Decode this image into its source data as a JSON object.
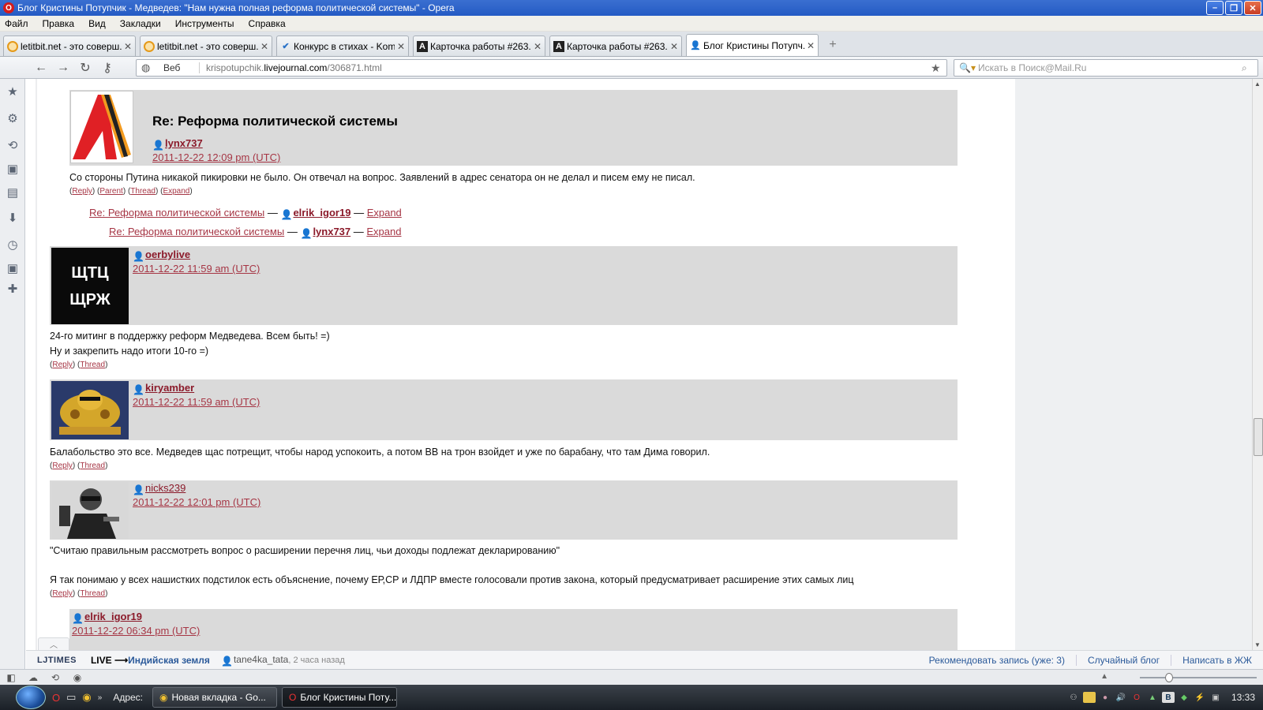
{
  "window": {
    "title": "Блог Кристины Потупчик - Медведев: \"Нам нужна полная реформа политической системы\" - Opera"
  },
  "menu": [
    "Файл",
    "Правка",
    "Вид",
    "Закладки",
    "Инструменты",
    "Справка"
  ],
  "tabs": [
    {
      "label": "letitbit.net - это соверш...",
      "icon": "letitbit-icon"
    },
    {
      "label": "letitbit.net - это соверш...",
      "icon": "letitbit-icon"
    },
    {
      "label": "Конкурс в стихах - Kom...",
      "icon": "konkurs-icon"
    },
    {
      "label": "Карточка работы #263...",
      "icon": "a-icon"
    },
    {
      "label": "Карточка работы #263...",
      "icon": "a-icon"
    },
    {
      "label": "Блог Кристины Потупч...",
      "icon": "lj-user-icon",
      "active": true
    }
  ],
  "address": {
    "mode": "Веб",
    "url_prefix": "krispotupchik.",
    "url_domain": "livejournal.com",
    "url_path": "/306871.html",
    "search_placeholder": "Искать в Поиск@Mail.Ru"
  },
  "comments": {
    "c1": {
      "heading": "Re: Реформа политической системы",
      "user": "lynx737",
      "date": "2011-12-22 12:09 pm (UTC)",
      "text": "Со стороны Путина никакой пикировки не было. Он отвечал на вопрос. Заявлений в адрес сенатора он не делал и писем ему не писал.",
      "links": [
        "Reply",
        "Parent",
        "Thread",
        "Expand"
      ]
    },
    "t1": {
      "title": "Re: Реформа политической системы",
      "user": "elrik_igor19",
      "expand": "Expand",
      "sep": "—"
    },
    "t2": {
      "title": "Re: Реформа политической системы",
      "user": "lynx737",
      "expand": "Expand",
      "sep": "—"
    },
    "c2": {
      "user": "oerbylive",
      "date": "2011-12-22 11:59 am (UTC)",
      "avatar_line1": "ЩТЦ",
      "avatar_line2": "ЩРЖ",
      "text1": "24-го митинг в поддержку реформ Медведева. Всем быть! =)",
      "text2": "Ну и закрепить надо итоги 10-го =)",
      "links": [
        "Reply",
        "Thread"
      ]
    },
    "c3": {
      "user": "kiryamber",
      "date": "2011-12-22 11:59 am (UTC)",
      "text": "Балабольство это все. Медведев щас потрещит, чтобы народ успокоить, а потом ВВ на трон взойдет и уже по барабану, что там Дима говорил.",
      "links": [
        "Reply",
        "Thread"
      ]
    },
    "c4": {
      "user": "nicks239",
      "date": "2011-12-22 12:01 pm (UTC)",
      "text1": "\"Считаю правильным рассмотреть вопрос о расширении перечня лиц, чьи доходы подлежат декларированию\"",
      "text2": "Я так понимаю у всех нашистких подстилок есть объяснение, почему ЕР,СР и ЛДПР вместе голосовали против закона, который предусматривает расширение этих самых лиц",
      "links": [
        "Reply",
        "Thread"
      ]
    },
    "c5": {
      "user": "elrik_igor19",
      "date": "2011-12-22 06:34 pm (UTC)"
    }
  },
  "ljtimes": {
    "brand": "LJTIMES",
    "live": "LIVE",
    "arrow": "⟶",
    "topic": "Индийская земля",
    "user": "tane4ka_tata",
    "ago": ", 2 часа назад",
    "recommend": "Рекомендовать запись (уже: 3)",
    "random": "Случайный блог",
    "write": "Написать в ЖЖ"
  },
  "taskbar": {
    "address_label": "Адрес:",
    "windows": [
      {
        "label": "Новая вкладка - Go..."
      },
      {
        "label": "Блог Кристины Поту..."
      }
    ],
    "clock": "13:33"
  },
  "colors": {
    "link": "#a63645",
    "username": "#8b1a2a",
    "comment_header_bg": "#dadada",
    "titlebar": "#245ac4"
  }
}
